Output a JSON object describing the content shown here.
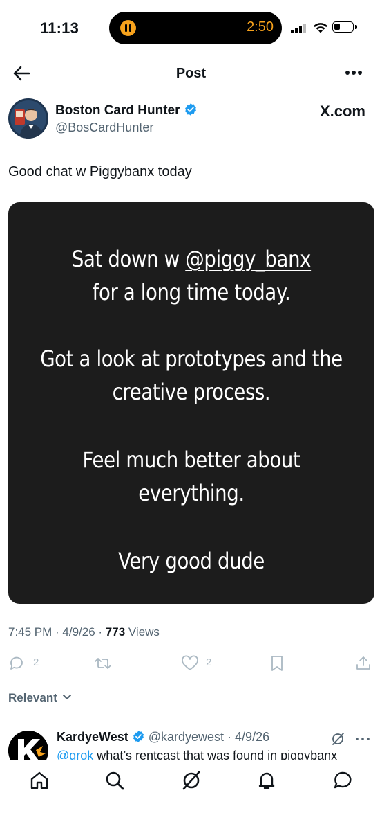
{
  "status_bar": {
    "time": "11:13",
    "media_timer": "2:50",
    "accent_color": "#f7a21c"
  },
  "nav": {
    "back_icon": "arrow-left-icon",
    "title": "Post",
    "more_icon": "more-horizontal-icon"
  },
  "tweet": {
    "author": {
      "display_name": "Boston Card Hunter",
      "handle": "@BosCardHunter",
      "verified": true
    },
    "source_label": "X.com",
    "text": "Good chat w Piggybanx today",
    "image_text": {
      "line1_prefix": "Sat down w",
      "line1_mention": "@piggy_banx",
      "line2": "for a long time today.",
      "line3": "Got a look at prototypes and the",
      "line4": "creative process.",
      "line5": "Feel much better about",
      "line6": "everything.",
      "line7": "Very good dude"
    },
    "timestamp": "7:45 PM · 4/9/26 · ",
    "views_count": "773",
    "views_label": " Views",
    "actions": {
      "reply_count": "2",
      "repost_count": "",
      "like_count": "2"
    }
  },
  "replies_filter": {
    "label": "Relevant"
  },
  "reply": {
    "display_name": "KardyeWest",
    "handle_date": "@kardyewest · 4/9/26",
    "mention": "@grok",
    "text": " what’s rentcast that was found in piggybanx"
  },
  "tabbar": {
    "items": [
      "home-icon",
      "search-icon",
      "grok-icon",
      "notifications-icon",
      "messages-icon"
    ]
  },
  "colors": {
    "link": "#1d9bf0",
    "secondary_text": "#536471",
    "media_bg": "#1c1c1c"
  }
}
